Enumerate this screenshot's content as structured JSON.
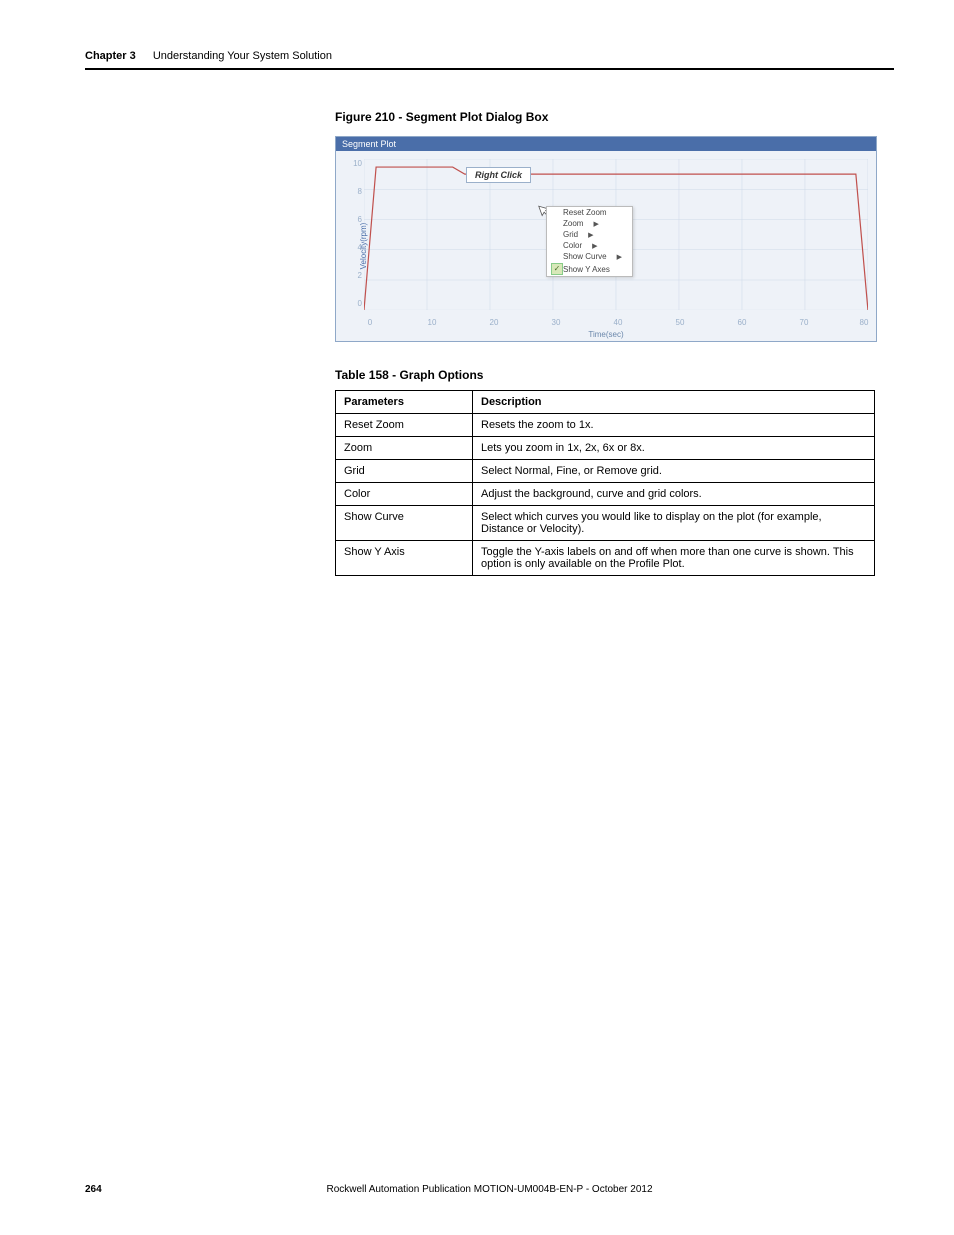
{
  "header": {
    "chapter": "Chapter 3",
    "title": "Understanding Your System Solution"
  },
  "figure": {
    "caption": "Figure 210 - Segment Plot Dialog Box",
    "chart_title": "Segment Plot",
    "right_click_label": "Right Click",
    "y_label": "Velocity(rpm)",
    "x_label": "Time(sec)"
  },
  "menu": {
    "items": [
      {
        "label": "Reset Zoom",
        "arrow": false,
        "checked": false
      },
      {
        "label": "Zoom",
        "arrow": true,
        "checked": false
      },
      {
        "label": "Grid",
        "arrow": true,
        "checked": false
      },
      {
        "label": "Color",
        "arrow": true,
        "checked": false
      },
      {
        "label": "Show Curve",
        "arrow": true,
        "checked": false
      },
      {
        "label": "Show Y Axes",
        "arrow": false,
        "checked": true
      }
    ]
  },
  "chart_data": {
    "type": "line",
    "title": "Segment Plot",
    "xlabel": "Time(sec)",
    "ylabel": "Velocity(rpm)",
    "x_ticks": [
      0,
      10,
      20,
      30,
      40,
      50,
      60,
      70,
      80
    ],
    "y_ticks": [
      0,
      2,
      4,
      6,
      8,
      10
    ],
    "xlim": [
      0,
      80
    ],
    "ylim": [
      0,
      10
    ],
    "series": [
      {
        "name": "Velocity",
        "x": [
          0,
          2,
          14,
          16,
          40,
          60,
          78,
          80
        ],
        "y": [
          0,
          9.5,
          9.5,
          9.0,
          9.0,
          9.0,
          9.0,
          0
        ]
      }
    ]
  },
  "table": {
    "caption": "Table 158 - Graph Options",
    "headers": {
      "param": "Parameters",
      "desc": "Description"
    },
    "rows": [
      {
        "param": "Reset Zoom",
        "desc": "Resets the zoom to 1x."
      },
      {
        "param": "Zoom",
        "desc": "Lets you zoom in 1x, 2x, 6x or 8x."
      },
      {
        "param": "Grid",
        "desc": "Select Normal, Fine, or Remove grid."
      },
      {
        "param": "Color",
        "desc": "Adjust the background, curve and grid colors."
      },
      {
        "param": "Show Curve",
        "desc": "Select which curves you would like to display on the plot (for example, Distance or Velocity)."
      },
      {
        "param": "Show Y Axis",
        "desc": "Toggle the Y-axis labels on and off when more than one curve is shown. This option is only available on the Profile Plot."
      }
    ]
  },
  "footer": {
    "page": "264",
    "pub": "Rockwell Automation Publication MOTION-UM004B-EN-P - October 2012"
  }
}
